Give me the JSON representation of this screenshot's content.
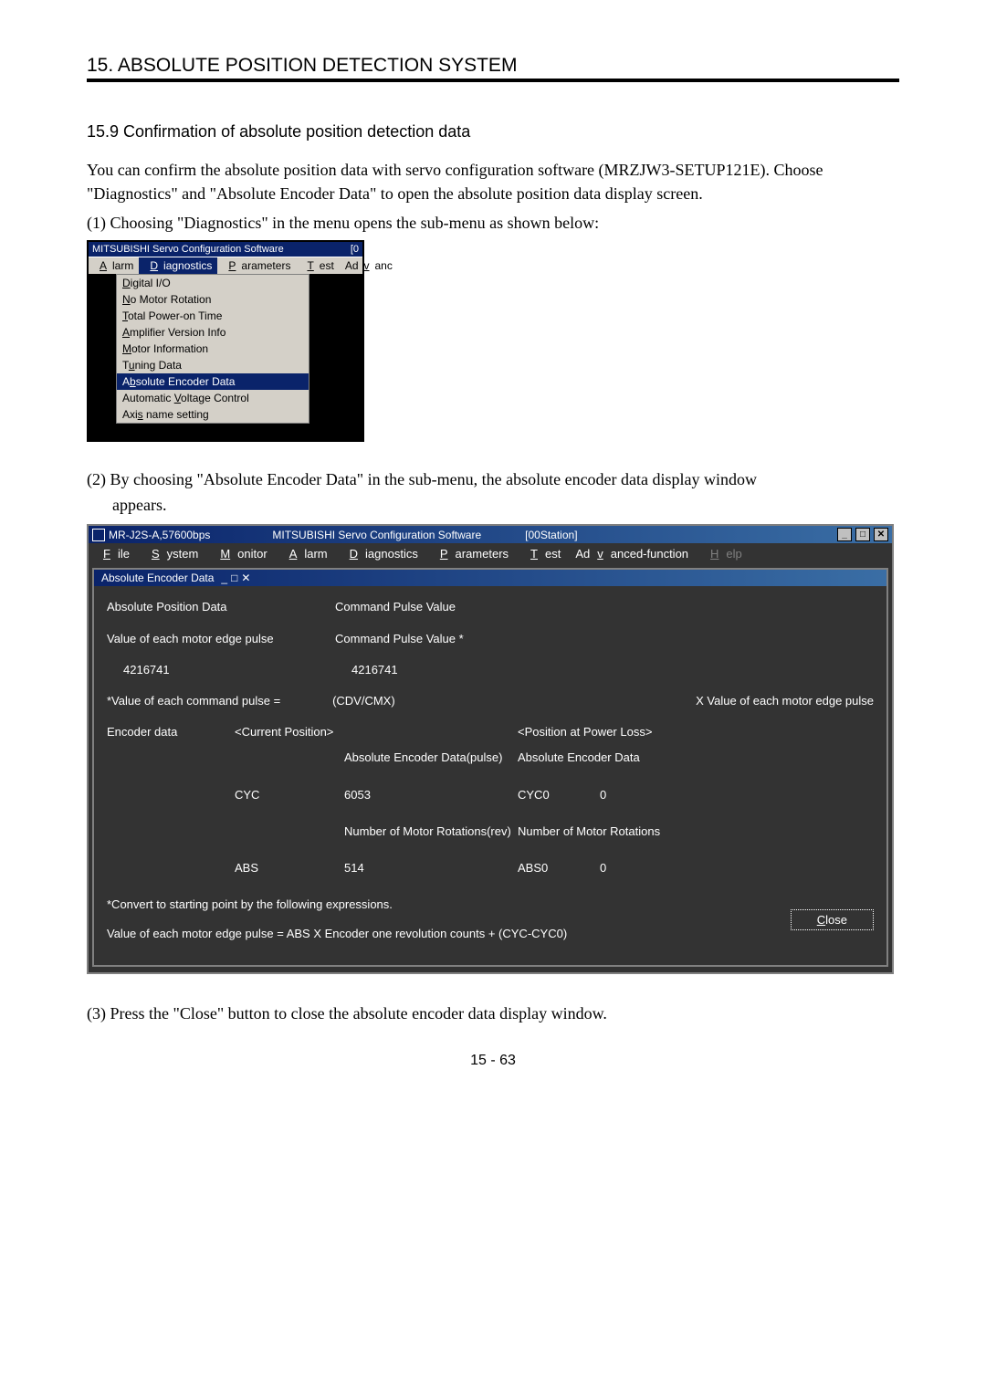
{
  "chapter_title": "15. ABSOLUTE POSITION DETECTION SYSTEM",
  "section_title": "15.9 Confirmation of absolute position detection data",
  "para1": "You can confirm the absolute position data with servo configuration software (MRZJW3-SETUP121E). Choose \"Diagnostics\" and \"Absolute Encoder Data\" to open the absolute position data display screen.",
  "step1": "(1) Choosing \"Diagnostics\" in the menu opens the sub-menu as shown below:",
  "win1": {
    "title": "MITSUBISHI Servo Configuration Software",
    "title_suffix": "[0",
    "menu": {
      "alarm": "Alarm",
      "diagnostics": "Diagnostics",
      "parameters": "Parameters",
      "test": "Test",
      "advanc": "Advanc"
    },
    "dd": {
      "digital_io": "Digital I/O",
      "no_motor": "No Motor Rotation",
      "total_power": "Total Power-on Time",
      "amp_ver": "Amplifier Version Info",
      "motor_info": "Motor Information",
      "tuning": "Tuning Data",
      "abs_enc": "Absolute Encoder Data",
      "avc": "Automatic Voltage Control",
      "axis": "Axis name setting"
    }
  },
  "step2_a": "(2) By choosing \"Absolute Encoder Data\" in the sub-menu, the absolute encoder data display window",
  "step2_b": "appears.",
  "win2": {
    "title_left": "MR-J2S-A,57600bps",
    "title_center": "MITSUBISHI Servo Configuration Software",
    "title_right": "[00Station]",
    "menu": {
      "file": "File",
      "system": "System",
      "monitor": "Monitor",
      "alarm": "Alarm",
      "diag": "Diagnostics",
      "param": "Parameters",
      "test": "Test",
      "adv": "Advanced-function",
      "help": "Help"
    },
    "sub_title": "Absolute Encoder Data",
    "labels": {
      "apd": "Absolute Position Data",
      "cpv": "Command Pulse Value",
      "vemep": "Value of each motor edge pulse",
      "cpv_star": "Command Pulse Value *",
      "val1": "4216741",
      "val2": "4216741",
      "vecp": "*Value of each command pulse =",
      "cdvcmx": "(CDV/CMX)",
      "xvemep": "X Value of each motor edge pulse",
      "encdata": "Encoder data",
      "curpos": "<Current Position>",
      "posloss": "<Position at Power Loss>",
      "aedp": "Absolute Encoder Data(pulse)",
      "aed": "Absolute Encoder Data",
      "cyc": "CYC",
      "cyc_v": "6053",
      "cyc0": "CYC0",
      "cyc0_v": "0",
      "nmrrev": "Number of Motor Rotations(rev)",
      "nmr": "Number of Motor Rotations",
      "abs": "ABS",
      "abs_v": "514",
      "abs0": "ABS0",
      "abs0_v": "0",
      "conv": "*Convert to starting point by the following expressions.",
      "formula": "Value of each motor edge pulse =  ABS X Encoder one revolution counts + (CYC-CYC0)",
      "close": "Close"
    }
  },
  "step3": "(3) Press the \"Close\" button to close the absolute encoder data display window.",
  "page_num": "15 -  63"
}
